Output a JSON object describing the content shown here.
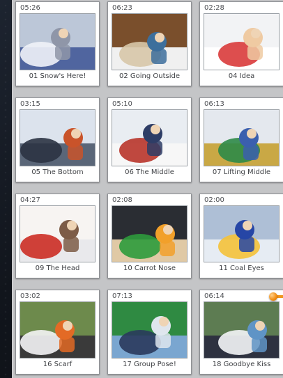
{
  "clips": [
    {
      "duration": "05:26",
      "title": "01 Snow's Here!",
      "scene": "scene-snowy-yard-icon",
      "colors": [
        "#bcc7d8",
        "#eff2f8",
        "#8f96a8",
        "#50659f"
      ]
    },
    {
      "duration": "06:23",
      "title": "02 Going Outside",
      "scene": "scene-doorway-icon",
      "colors": [
        "#7a4f2c",
        "#d7c6a8",
        "#3d6f9c",
        "#f0f0f0"
      ]
    },
    {
      "duration": "02:28",
      "title": "04 Idea",
      "scene": "scene-child-red-hat-icon",
      "colors": [
        "#f2f3f5",
        "#d93b3b",
        "#efcaa2",
        "#ffffff"
      ]
    },
    {
      "duration": "03:15",
      "title": "05 The Bottom",
      "scene": "scene-kids-snowbank-icon",
      "colors": [
        "#dce3ed",
        "#2b3342",
        "#c9532a",
        "#5a6678"
      ]
    },
    {
      "duration": "05:10",
      "title": "06 The Middle",
      "scene": "scene-rolling-snowball-icon",
      "colors": [
        "#e9edf2",
        "#b8342a",
        "#2e3d66",
        "#f7f7f7"
      ]
    },
    {
      "duration": "06:13",
      "title": "07 Lifting Middle",
      "scene": "scene-lifting-snowball-icon",
      "colors": [
        "#e4e8ee",
        "#2d8a47",
        "#3b5fae",
        "#c9a845"
      ]
    },
    {
      "duration": "04:27",
      "title": "09 The Head",
      "scene": "scene-snowman-head-icon",
      "colors": [
        "#f7f4f2",
        "#cc2d25",
        "#7d5c47",
        "#e9e9ec"
      ]
    },
    {
      "duration": "02:08",
      "title": "10 Carrot Nose",
      "scene": "scene-green-hat-child-icon",
      "colors": [
        "#2a2d33",
        "#2e9b3c",
        "#f2a02a",
        "#e0c9a5"
      ]
    },
    {
      "duration": "02:00",
      "title": "11 Coal Eyes",
      "scene": "scene-yellow-hat-child-icon",
      "colors": [
        "#aebfd6",
        "#f4c23a",
        "#2646a6",
        "#e6ecf3"
      ]
    },
    {
      "duration": "03:02",
      "title": "16 Scarf",
      "scene": "scene-snowman-face-icon",
      "colors": [
        "#6d8a4c",
        "#f4f4f6",
        "#e36a25",
        "#3a3a3a"
      ]
    },
    {
      "duration": "07:13",
      "title": "17 Group Pose!",
      "scene": "scene-group-pose-icon",
      "colors": [
        "#2f8a42",
        "#2a3a5c",
        "#dfe6ee",
        "#7aa6d0"
      ]
    },
    {
      "duration": "06:14",
      "title": "18 Goodbye Kiss",
      "scene": "scene-goodbye-snowman-icon",
      "colors": [
        "#5d7c52",
        "#f4f5f7",
        "#5f94c6",
        "#2e3240"
      ]
    }
  ]
}
